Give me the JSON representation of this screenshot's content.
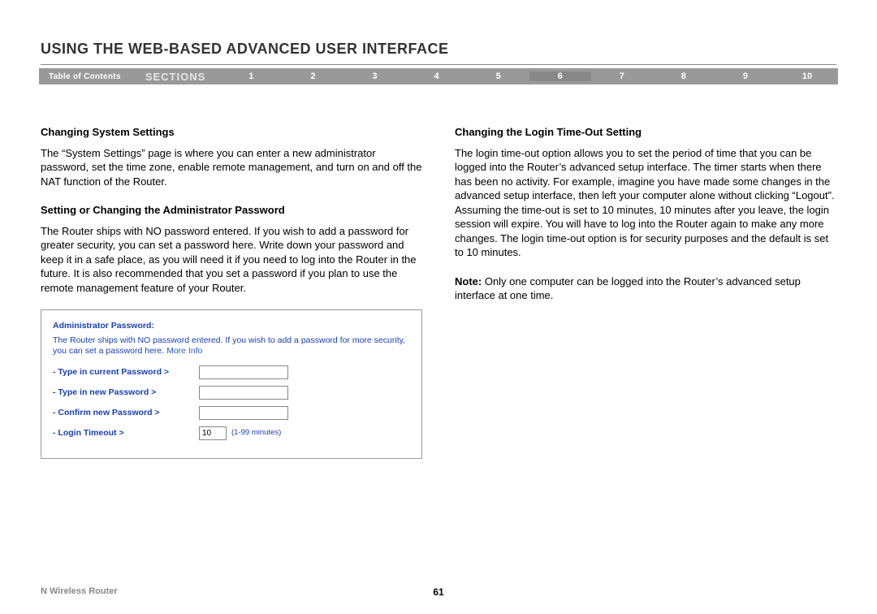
{
  "page_title": "USING THE WEB-BASED ADVANCED USER INTERFACE",
  "navbar": {
    "toc": "Table of Contents",
    "sections_label": "SECTIONS",
    "items": [
      "1",
      "2",
      "3",
      "4",
      "5",
      "6",
      "7",
      "8",
      "9",
      "10"
    ],
    "active": "6"
  },
  "left": {
    "h1": "Changing System Settings",
    "p1": "The “System Settings” page is where you can enter a new administrator password, set the time zone, enable remote management, and turn on and off the NAT function of the Router.",
    "h2": "Setting or Changing the Administrator Password",
    "p2": "The Router ships with NO password entered. If you wish to add a password for greater security, you can set a password here. Write down your password and keep it in a safe place, as you will need it if you need to log into the Router in the future. It is also recommended that you set a password if you plan to use the remote management feature of your Router.",
    "admin_box": {
      "title": "Administrator Password:",
      "desc": "The Router ships with NO password entered. If you wish to add a password for more security, you can set a password here. ",
      "more_info": "More Info",
      "rows": {
        "current": "- Type in current Password >",
        "new": "- Type in new Password >",
        "confirm": "- Confirm new Password >",
        "timeout": "- Login Timeout >"
      },
      "timeout_value": "10",
      "timeout_hint": "(1-99 minutes)"
    }
  },
  "right": {
    "h1": "Changing the Login Time-Out Setting",
    "p1": "The login time-out option allows you to set the period of time that you can be logged into the Router’s advanced setup interface. The timer starts when there has been no activity. For example, imagine you have made some changes in the advanced setup interface, then left your computer alone without clicking “Logout”. Assuming the time-out is set to 10 minutes, 10 minutes after you leave, the login session will expire. You will have to log into the Router again to make any more changes. The login time-out option is for security purposes and the default is set to 10 minutes.",
    "note_label": "Note:",
    "note_text": " Only one computer can be logged into the Router’s advanced setup interface at one time."
  },
  "footer": {
    "product": "N Wireless Router",
    "page": "61"
  }
}
